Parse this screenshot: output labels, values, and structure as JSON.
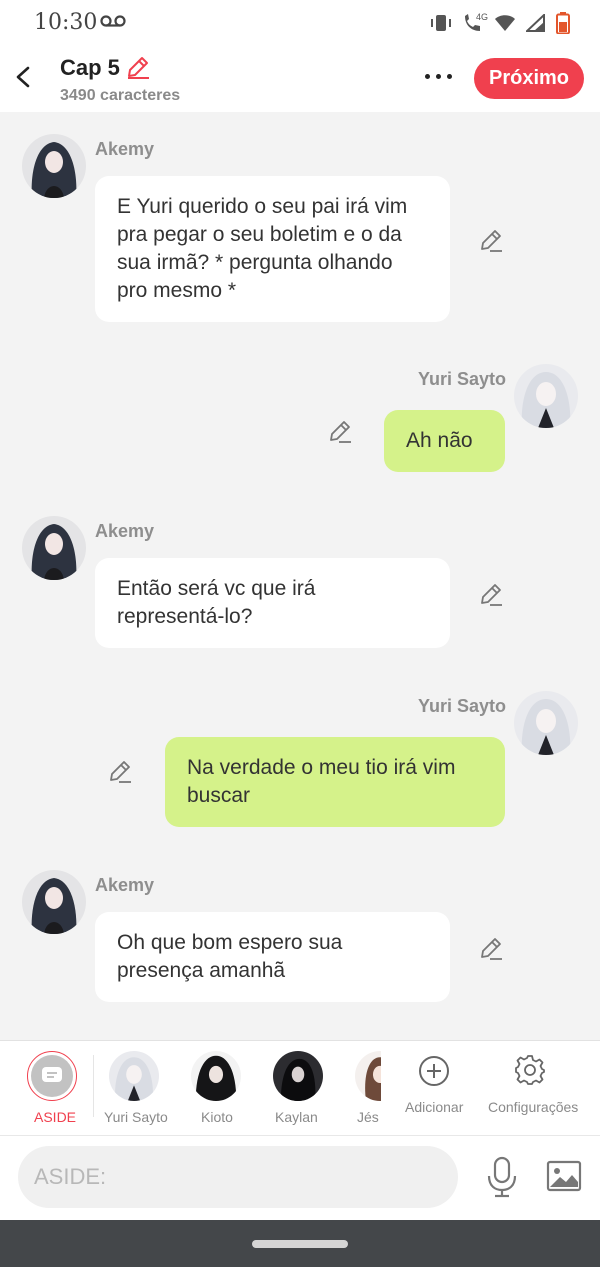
{
  "status_bar": {
    "time": "10:30",
    "network_label": "4G"
  },
  "header": {
    "title": "Cap 5",
    "subtitle": "3490 caracteres",
    "next_label": "Próximo"
  },
  "messages": [
    {
      "sender": "Akemy",
      "side": "left",
      "text": "E Yuri querido o seu pai irá vim pra pegar o seu boletim e o da sua irmã? * pergunta olhando pro mesmo *"
    },
    {
      "sender": "Yuri Sayto",
      "side": "right",
      "text": "Ah não"
    },
    {
      "sender": "Akemy",
      "side": "left",
      "text": "Então será vc que irá representá-lo?"
    },
    {
      "sender": "Yuri Sayto",
      "side": "right",
      "text": "Na verdade o meu tio irá vim buscar"
    },
    {
      "sender": "Akemy",
      "side": "left",
      "text": "Oh que bom espero sua presença amanhã"
    }
  ],
  "characters": {
    "aside_label": "ASIDE",
    "items": [
      {
        "label": "Yuri Sayto"
      },
      {
        "label": "Kioto"
      },
      {
        "label": "Kaylan"
      },
      {
        "label": "Jés"
      }
    ],
    "add_label": "Adicionar",
    "settings_label": "Configurações"
  },
  "input": {
    "placeholder": "ASIDE:",
    "value": ""
  },
  "colors": {
    "accent": "#f0404e",
    "bubble_green": "#d5f28a",
    "bubble_white": "#ffffff",
    "background": "#f3f3f3"
  }
}
